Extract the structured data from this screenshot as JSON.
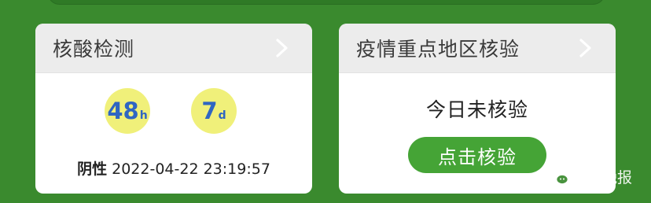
{
  "left_card": {
    "title": "核酸检测",
    "badge_hours": {
      "value": "48",
      "unit": "h"
    },
    "badge_days": {
      "value": "7",
      "unit": "d"
    },
    "result_status": "阴性",
    "result_time": "2022-04-22 23:19:57"
  },
  "right_card": {
    "title": "疫情重点地区核验",
    "status": "今日未核验",
    "button_label": "点击核验"
  },
  "watermark": {
    "text": "齐鲁晚报"
  },
  "colors": {
    "background": "#3a8a2e",
    "badge": "#f0f07a",
    "badge_text": "#2f66c2",
    "button": "#45a436"
  },
  "icons": [
    "chevron-right-icon",
    "wechat-icon"
  ]
}
